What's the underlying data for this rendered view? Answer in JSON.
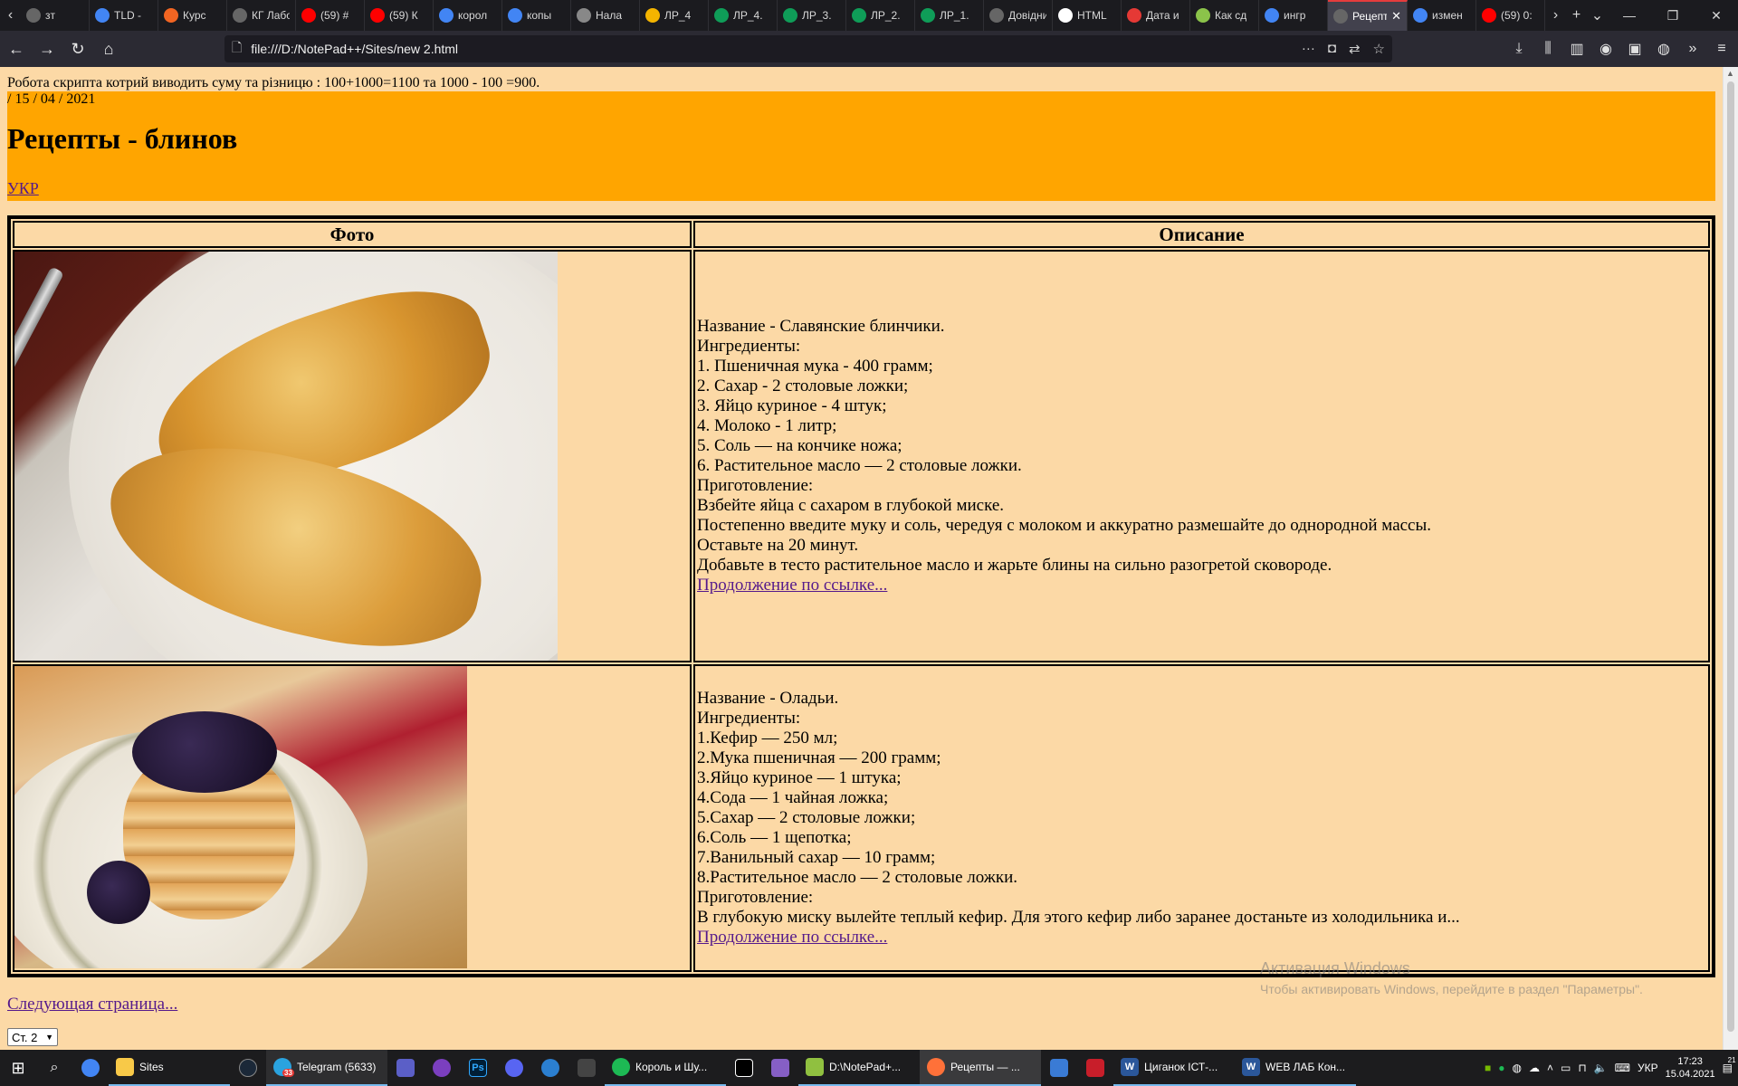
{
  "browser": {
    "tabs": [
      {
        "label": "зт",
        "icon": "page-icon",
        "color": "#666666"
      },
      {
        "label": "TLD -",
        "icon": "google-icon",
        "color": "#4285F4"
      },
      {
        "label": "Курс",
        "icon": "prometheus-icon",
        "color": "#F26522"
      },
      {
        "label": "КГ Лабора",
        "icon": "page-icon",
        "color": "#666666"
      },
      {
        "label": "(59) #",
        "icon": "youtube-icon",
        "color": "#FF0000"
      },
      {
        "label": "(59) К",
        "icon": "youtube-icon",
        "color": "#FF0000"
      },
      {
        "label": "корол",
        "icon": "google-icon",
        "color": "#4285F4"
      },
      {
        "label": "копы",
        "icon": "google-icon",
        "color": "#4285F4"
      },
      {
        "label": "Нала",
        "icon": "bulb-icon",
        "color": "#888888"
      },
      {
        "label": "ЛР_4",
        "icon": "slides-icon",
        "color": "#F4B400"
      },
      {
        "label": "ЛР_4.",
        "icon": "drive-icon",
        "color": "#0F9D58"
      },
      {
        "label": "ЛР_3.",
        "icon": "drive-icon",
        "color": "#0F9D58"
      },
      {
        "label": "ЛР_2.",
        "icon": "drive-icon",
        "color": "#0F9D58"
      },
      {
        "label": "ЛР_1.",
        "icon": "drive-icon",
        "color": "#0F9D58"
      },
      {
        "label": "Довідник",
        "icon": "page-icon",
        "color": "#666666"
      },
      {
        "label": "HTML",
        "icon": "wikipedia-icon",
        "color": "#FFFFFF"
      },
      {
        "label": "Дата и",
        "icon": "tool-icon",
        "color": "#E53935"
      },
      {
        "label": "Как сд",
        "icon": "flower-icon",
        "color": "#8BC34A"
      },
      {
        "label": "ингр",
        "icon": "google-icon",
        "color": "#4285F4"
      },
      {
        "label": "Рецепт",
        "icon": "page-icon",
        "color": "#666666",
        "active": true
      },
      {
        "label": "измен",
        "icon": "google-icon",
        "color": "#4285F4"
      },
      {
        "label": "(59) 0:",
        "icon": "youtube-icon",
        "color": "#FF0000"
      }
    ],
    "url": "file:///D:/NotePad++/Sites/new 2.html"
  },
  "page": {
    "script_result": "Робота скрипта котрий виводить суму та різницю : 100+1000=1100 та 1000 - 100 =900.",
    "date": "/ 15 / 04 / 2021",
    "title": "Рецепты - блинов",
    "lang_link": "УКР",
    "table": {
      "headers": [
        "Фото",
        "Описание"
      ],
      "rows": [
        {
          "image_alt": "Славянские блинчики",
          "lines": [
            "Название - Славянские блинчики.",
            "Ингредиенты:",
            "1. Пшеничная мука - 400 грамм;",
            "2. Сахар - 2 столовые ложки;",
            "3. Яйцо куриное - 4 штук;",
            "4. Молоко - 1 литр;",
            "5. Соль — на кончике ножа;",
            "6. Растительное масло — 2 столовые ложки.",
            "Приготовление:",
            "Взбейте яйца с сахаром в глубокой миске.",
            "Постепенно введите муку и соль, чередуя с молоком и аккуратно размешайте до однородной массы.",
            "Оставьте на 20 минут.",
            "Добавьте в тесто растительное масло и жарьте блины на сильно разогретой сковороде."
          ],
          "link": "Продолжение по ссылке..."
        },
        {
          "image_alt": "Оладьи",
          "lines": [
            "Название - Оладьи.",
            "Ингредиенты:",
            "1.Кефир — 250 мл;",
            "2.Мука пшеничная — 200 грамм;",
            "3.Яйцо куриное — 1 штука;",
            "4.Сода — 1 чайная ложка;",
            "5.Сахар — 2 столовые ложки;",
            "6.Соль — 1 щепотка;",
            "7.Ванильный сахар — 10 грамм;",
            "8.Растительное масло — 2 столовые ложки.",
            "Приготовление:",
            "В глубокую миску вылейте теплый кефир. Для этого кефир либо заранее достаньте из холодильника и..."
          ],
          "link": "Продолжение по ссылке..."
        }
      ]
    },
    "next_link": "Следующая страница...",
    "page_select": "Ст. 2"
  },
  "watermark": {
    "line1": "Активация Windows",
    "line2": "Чтобы активировать Windows, перейдите в раздел \"Параметры\"."
  },
  "taskbar": {
    "apps": [
      {
        "label": "Sites",
        "icon": "folder-icon",
        "color": "#F8C948"
      },
      {
        "label": "Telegram (5633)",
        "icon": "telegram-icon",
        "color": "#2AA3DF"
      },
      {
        "label": "Король и Шу...",
        "icon": "spotify-icon",
        "color": "#1DB954"
      },
      {
        "label": "D:\\NotePad+...",
        "icon": "notepad-icon",
        "color": "#90C040"
      },
      {
        "label": "Рецепты — ...",
        "icon": "firefox-icon",
        "color": "#FF7139",
        "active": true
      },
      {
        "label": "Циганок ІСТ-...",
        "icon": "word-icon",
        "color": "#2B579A"
      },
      {
        "label": "WEB ЛАБ Кон...",
        "icon": "word-icon",
        "color": "#2B579A"
      }
    ],
    "telegram_badge": "33",
    "lang": "УКР",
    "time": "17:23",
    "date": "15.04.2021",
    "notif_count": "21"
  }
}
